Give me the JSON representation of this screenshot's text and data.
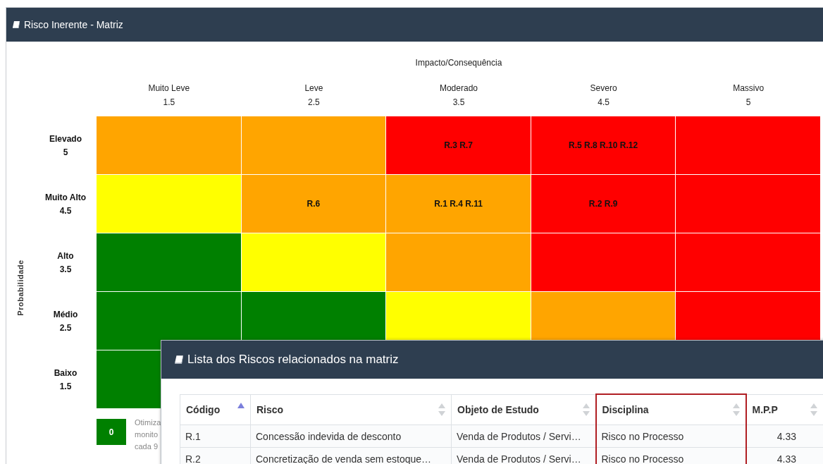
{
  "panel": {
    "title": "Risco Inerente - Matriz"
  },
  "matrix": {
    "x_axis_title": "Impacto/Consequência",
    "y_axis_title": "Probabilidade",
    "columns": [
      {
        "label": "Muito Leve",
        "value": "1.5"
      },
      {
        "label": "Leve",
        "value": "2.5"
      },
      {
        "label": "Moderado",
        "value": "3.5"
      },
      {
        "label": "Severo",
        "value": "4.5"
      },
      {
        "label": "Massivo",
        "value": "5"
      }
    ],
    "rows": [
      {
        "label": "Elevado",
        "value": "5",
        "cells": [
          {
            "color": "#ffa500"
          },
          {
            "color": "#ffa500"
          },
          {
            "color": "#ff0000",
            "text": "R.3 R.7"
          },
          {
            "color": "#ff0000",
            "text": "R.5 R.8 R.10 R.12"
          },
          {
            "color": "#ff0000"
          }
        ]
      },
      {
        "label": "Muito Alto",
        "value": "4.5",
        "cells": [
          {
            "color": "#ffff00"
          },
          {
            "color": "#ffa500",
            "text": "R.6"
          },
          {
            "color": "#ffa500",
            "text": "R.1 R.4 R.11"
          },
          {
            "color": "#ff0000",
            "text": "R.2 R.9"
          },
          {
            "color": "#ff0000"
          }
        ]
      },
      {
        "label": "Alto",
        "value": "3.5",
        "cells": [
          {
            "color": "#008000"
          },
          {
            "color": "#ffff00"
          },
          {
            "color": "#ffa500"
          },
          {
            "color": "#ff0000"
          },
          {
            "color": "#ff0000"
          }
        ]
      },
      {
        "label": "Médio",
        "value": "2.5",
        "cells": [
          {
            "color": "#008000"
          },
          {
            "color": "#008000"
          },
          {
            "color": "#ffff00"
          },
          {
            "color": "#ffa500"
          },
          {
            "color": "#ff0000"
          }
        ]
      },
      {
        "label": "Baixo",
        "value": "1.5",
        "cells": [
          {
            "color": "#008000"
          }
        ]
      }
    ]
  },
  "legend": [
    {
      "count": "0",
      "color": "#008000",
      "lines": [
        "Otimiza",
        "monito",
        "cada 9"
      ]
    }
  ],
  "modal": {
    "title": "Lista dos Riscos relacionados na matriz",
    "table": {
      "columns": [
        {
          "label": "Código",
          "sorted": true,
          "highlighted": false
        },
        {
          "label": "Risco",
          "sorted": false,
          "highlighted": false
        },
        {
          "label": "Objeto de Estudo",
          "sorted": false,
          "highlighted": false
        },
        {
          "label": "Disciplina",
          "sorted": false,
          "highlighted": true
        },
        {
          "label": "M.P.P",
          "sorted": false,
          "highlighted": false
        }
      ],
      "rows": [
        [
          "R.1",
          "Concessão indevida de desconto",
          "Venda de Produtos / Servi…",
          "Risco no Processo",
          "4.33"
        ],
        [
          "R.2",
          "Concretização de venda sem estoque…",
          "Venda de Produtos / Servi…",
          "Risco no Processo",
          "4.33"
        ]
      ]
    }
  }
}
